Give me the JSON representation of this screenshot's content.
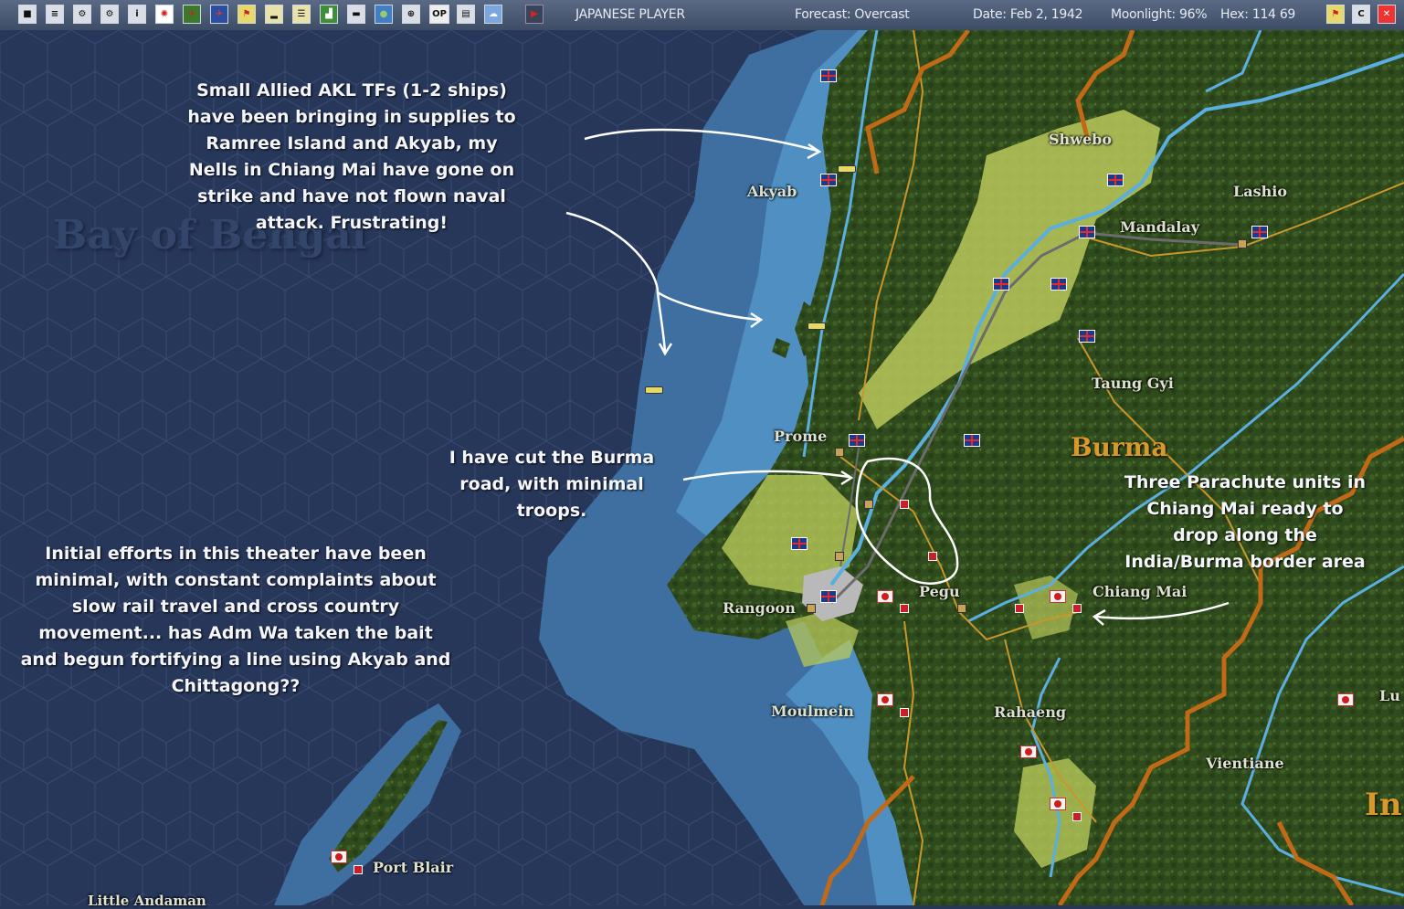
{
  "toolbar": {
    "buttons": [
      "save-icon",
      "document-icon",
      "group-icon",
      "group2-icon",
      "info-icon",
      "rising-sun-icon",
      "aircraft-icon",
      "aircraft-blue-icon",
      "flag-icon",
      "ship-icon",
      "stack-icon",
      "chart-icon",
      "base-icon",
      "globe-icon",
      "target-icon",
      "op-icon",
      "list-icon",
      "weather-icon"
    ],
    "op_label": "OP",
    "player": "JAPANESE PLAYER",
    "forecast": "Forecast: Overcast",
    "date": "Date: Feb 2, 1942",
    "moonlight": "Moonlight: 96%",
    "hex": "Hex: 114 69"
  },
  "map": {
    "places": {
      "akyab": "Akyab",
      "shwebo": "Shwebo",
      "lashio": "Lashio",
      "mandalay": "Mandalay",
      "taung_gyi": "Taung Gyi",
      "prome": "Prome",
      "rangoon": "Rangoon",
      "pegu": "Pegu",
      "chiang_mai": "Chiang Mai",
      "moulmein": "Moulmein",
      "rahaeng": "Rahaeng",
      "vientiane": "Vientiane",
      "port_blair": "Port Blair",
      "little_andaman": "Little Andaman",
      "lu": "Lu"
    },
    "region_burma": "Burma",
    "region_in": "In",
    "sea_name": "Bay of Bengal"
  },
  "annotations": {
    "akl": "Small Allied AKL TFs (1-2 ships) have been bringing in supplies to Ramree Island and Akyab, my Nells in Chiang Mai have gone on strike and have not flown naval attack.  Frustrating!",
    "burma_road": "I have cut the Burma road, with minimal troops.",
    "initial": "Initial efforts in this theater have been minimal, with constant complaints about slow rail travel and cross country movement... has Adm Wa taken the bait and begun fortifying a line using Akyab and Chittagong??",
    "parachute": "Three Parachute units in Chiang Mai ready to drop along the India/Burma border area"
  },
  "colors": {
    "deep_sea": "#27375a",
    "shallow_sea": "#3e6fa0",
    "coast_water": "#4f8fc2",
    "jungle": "#2f4a1c",
    "open_ground": "#b8c85a",
    "road": "#c8962a",
    "border_hex": "#c06a18",
    "allied_flag": "#1a3a8f",
    "japanese_flag": "#d21c1c"
  }
}
